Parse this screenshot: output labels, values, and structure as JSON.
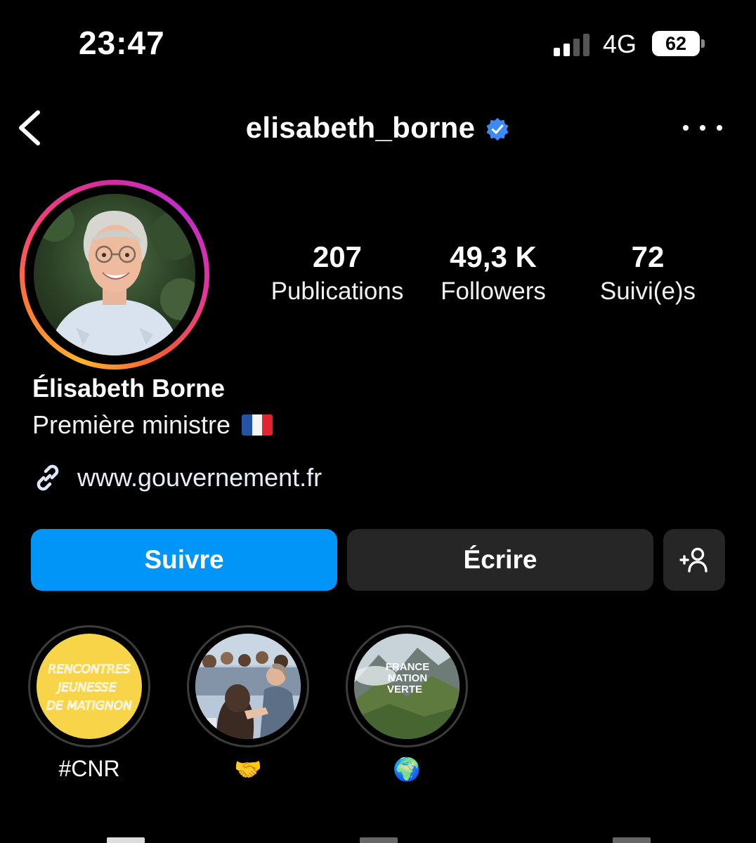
{
  "status_bar": {
    "time": "23:47",
    "network": "4G",
    "battery": "62",
    "signal_bars_active": 2,
    "signal_bars_total": 4
  },
  "header": {
    "back_icon": "chevron-left-icon",
    "username": "elisabeth_borne",
    "verified_icon": "verified-badge-icon",
    "more_icon": "more-horizontal-icon"
  },
  "stats": [
    {
      "value": "207",
      "label": "Publications"
    },
    {
      "value": "49,3 K",
      "label": "Followers"
    },
    {
      "value": "72",
      "label": "Suivi(e)s"
    }
  ],
  "profile": {
    "display_name": "Élisabeth Borne",
    "bio": "Première ministre",
    "bio_flag": "france-flag-icon",
    "link_icon": "link-icon",
    "link": "www.gouvernement.fr"
  },
  "actions": {
    "follow_label": "Suivre",
    "message_label": "Écrire",
    "add_user_icon": "add-user-icon"
  },
  "highlights": [
    {
      "label": "#CNR",
      "cover_text": [
        "RENCONTRES",
        "JEUNESSE",
        "DE MATIGNON"
      ]
    },
    {
      "label": "🤝",
      "cover_text": []
    },
    {
      "label": "🌍",
      "cover_text": [
        "FRANCE",
        "NATION",
        "VERTE"
      ]
    }
  ],
  "colors": {
    "background": "#000000",
    "follow_button": "#0095f6",
    "secondary_button": "#262626",
    "verified_badge": "#3d8af7",
    "highlight_yellow": "#f8d448"
  }
}
